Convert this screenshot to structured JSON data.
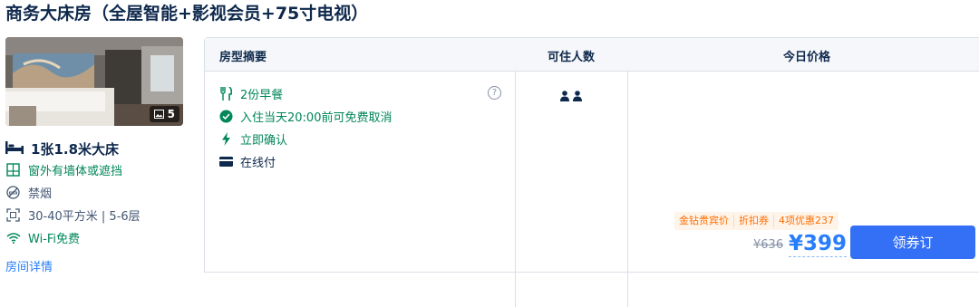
{
  "room": {
    "title": "商务大床房（全屋智能+影视会员+75寸电视）",
    "photo_count": "5",
    "bed": "1张1.8米大床",
    "features": [
      {
        "icon": "window-icon",
        "text": "窗外有墙体或遮挡",
        "highlight": true
      },
      {
        "icon": "no-smoking-icon",
        "text": "禁烟",
        "highlight": false
      },
      {
        "icon": "room-size-icon",
        "text": "30-40平方米 | 5-6层",
        "highlight": false
      },
      {
        "icon": "wifi-icon",
        "text": "Wi-Fi免费",
        "highlight": true
      }
    ],
    "more_link": "房间详情"
  },
  "table": {
    "headers": {
      "summary": "房型摘要",
      "guests": "可住人数",
      "price": "今日价格"
    },
    "summary": [
      {
        "icon": "breakfast-icon",
        "text": "2份早餐",
        "highlight": true
      },
      {
        "icon": "check-circle-icon",
        "text": "入住当天20:00前可免费取消",
        "highlight": true
      },
      {
        "icon": "lightning-icon",
        "text": "立即确认",
        "highlight": true
      },
      {
        "icon": "card-icon",
        "text": "在线付",
        "highlight": false
      }
    ],
    "help_symbol": "?",
    "guest_count": 2
  },
  "price": {
    "tags": [
      "金钻贵宾价",
      "折扣券",
      "4项优惠237"
    ],
    "original": "¥636",
    "current": "¥399",
    "book_label": "领券订"
  },
  "colors": {
    "accent": "#287dfa",
    "green": "#00865a",
    "orange": "#ff6f00",
    "button": "#3470f5"
  }
}
